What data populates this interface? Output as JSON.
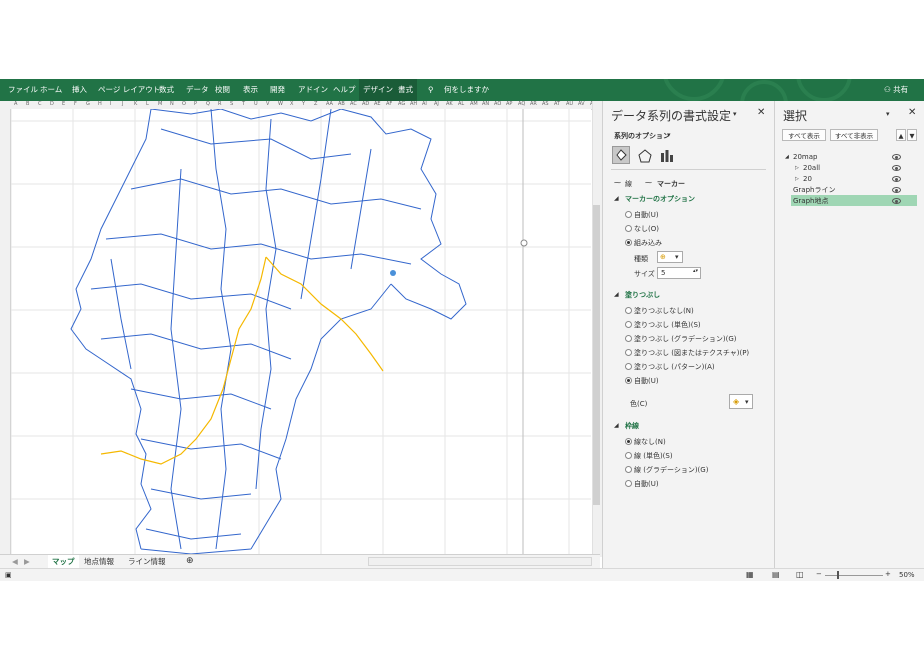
{
  "ribbon": {
    "tabs": [
      "ファイル",
      "ホーム",
      "挿入",
      "ページ レイアウト",
      "数式",
      "データ",
      "校閲",
      "表示",
      "開発",
      "アドイン",
      "ヘルプ",
      "デザイン",
      "書式"
    ],
    "tell_me": "何をしますか",
    "share": "共有",
    "active_tabs": [
      "デザイン",
      "書式"
    ]
  },
  "sheet": {
    "tabs": [
      "マップ",
      "地点情報",
      "ライン情報"
    ],
    "active_tab": "マップ",
    "column_letters": [
      "A",
      "B",
      "C",
      "D",
      "E",
      "F",
      "G",
      "H",
      "I",
      "J",
      "K",
      "L",
      "M",
      "N",
      "O",
      "P",
      "Q",
      "R",
      "S",
      "T",
      "U",
      "V",
      "W",
      "X",
      "Y",
      "Z",
      "AA",
      "AB",
      "AC",
      "AD",
      "AE",
      "AF",
      "AG",
      "AH",
      "AI",
      "AJ",
      "AK",
      "AL",
      "AM",
      "AN",
      "AO",
      "AP",
      "AQ",
      "AR",
      "AS",
      "AT",
      "AU",
      "AV",
      "AW"
    ]
  },
  "format_pane": {
    "title": "データ系列の書式設定",
    "series_options": "系列のオプション",
    "line_tab": "線",
    "marker_tab": "マーカー",
    "marker_options": {
      "heading": "マーカーのオプション",
      "options": [
        "自動(U)",
        "なし(O)",
        "組み込み"
      ],
      "selected": "組み込み",
      "type_label": "種類",
      "size_label": "サイズ",
      "size_value": "5"
    },
    "fill": {
      "heading": "塗りつぶし",
      "options": [
        "塗りつぶしなし(N)",
        "塗りつぶし (単色)(S)",
        "塗りつぶし (グラデーション)(G)",
        "塗りつぶし (図またはテクスチャ)(P)",
        "塗りつぶし (パターン)(A)",
        "自動(U)"
      ],
      "selected": "自動(U)",
      "color_label": "色(C)"
    },
    "border": {
      "heading": "枠線",
      "options": [
        "線なし(N)",
        "線 (単色)(S)",
        "線 (グラデーション)(G)",
        "自動(U)"
      ],
      "selected": "線なし(N)"
    }
  },
  "selection_pane": {
    "title": "選択",
    "show_all": "すべて表示",
    "hide_all": "すべて非表示",
    "items": [
      {
        "label": "20map",
        "indent": 0,
        "expand": "◢"
      },
      {
        "label": "20all",
        "indent": 1,
        "expand": "▷"
      },
      {
        "label": "20",
        "indent": 1,
        "expand": "▷"
      },
      {
        "label": "Graphライン",
        "indent": 0,
        "expand": ""
      },
      {
        "label": "Graph地点",
        "indent": 0,
        "expand": "",
        "selected": true
      }
    ]
  },
  "status": {
    "zoom": "50%"
  },
  "colors": {
    "excel_green": "#217346",
    "river_blue": "#3366cc",
    "route_yellow": "#f5b800",
    "selected_item": "#9fd6b4"
  }
}
